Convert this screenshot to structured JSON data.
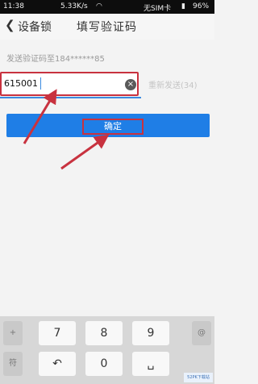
{
  "status_bar": {
    "time": "11:38",
    "speed": "5.33K/s",
    "sim": "无SIM卡",
    "battery": "96%"
  },
  "header": {
    "back_label": "设备锁",
    "title": "填写验证码"
  },
  "form": {
    "hint": "发送验证码至184******85",
    "code_value": "615001",
    "resend": "重新发送(34)",
    "confirm": "确定"
  },
  "keyboard": {
    "symbol_key": "+",
    "clipboard_key": "符",
    "keys_row1": [
      "7",
      "8",
      "9"
    ],
    "keys_row2": [
      "0"
    ],
    "at_key": "@",
    "back_key": "↶",
    "space_key": "␣"
  },
  "watermark": "52PK下载站"
}
